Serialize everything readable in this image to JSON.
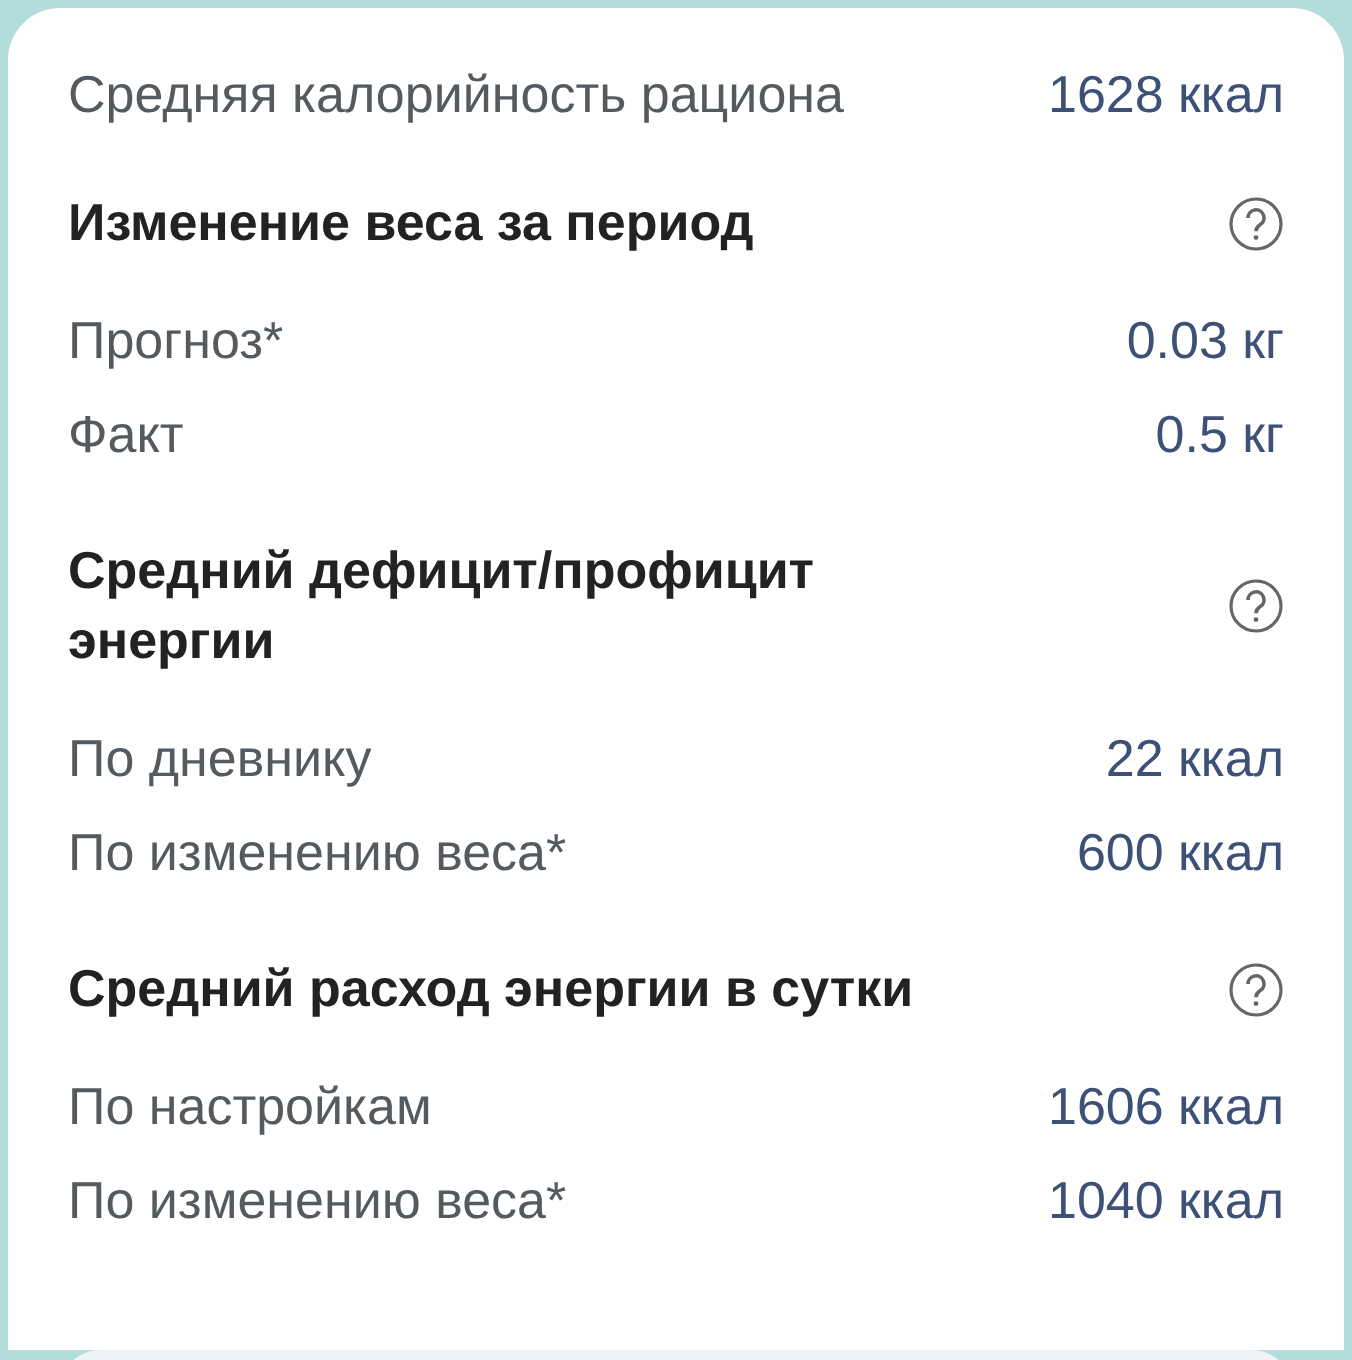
{
  "summary": {
    "label": "Средняя калорийность рациона",
    "value": "1628 ккал"
  },
  "sections": [
    {
      "title": "Изменение веса за период",
      "rows": [
        {
          "label": "Прогноз*",
          "value": "0.03 кг"
        },
        {
          "label": "Факт",
          "value": "0.5 кг"
        }
      ]
    },
    {
      "title": "Средний дефицит/профицит энергии",
      "rows": [
        {
          "label": "По дневнику",
          "value": "22 ккал"
        },
        {
          "label": "По изменению веса*",
          "value": "600 ккал"
        }
      ]
    },
    {
      "title": "Средний расход энергии в сутки",
      "rows": [
        {
          "label": "По настройкам",
          "value": "1606 ккал"
        },
        {
          "label": "По изменению веса*",
          "value": "1040 ккал"
        }
      ]
    }
  ]
}
